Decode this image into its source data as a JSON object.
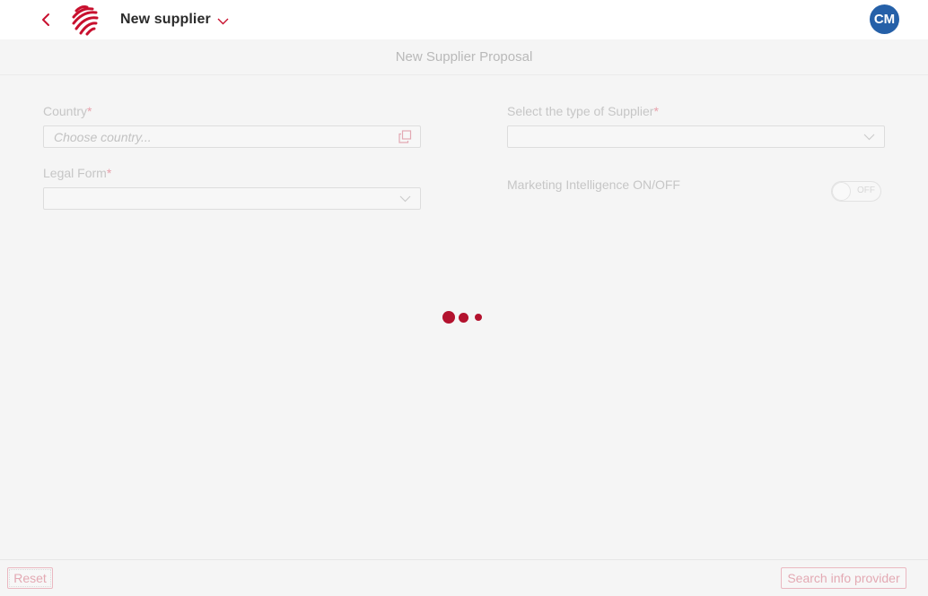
{
  "header": {
    "title": "New supplier",
    "avatar_initials": "CM",
    "avatar_color": "#2560a8",
    "brand_color": "#c8102e"
  },
  "subheader": {
    "title": "New Supplier Proposal"
  },
  "form": {
    "country": {
      "label": "Country",
      "required_mark": "*",
      "placeholder": "Choose country...",
      "value": ""
    },
    "legal_form": {
      "label": "Legal Form",
      "required_mark": "*",
      "value": ""
    },
    "supplier_type": {
      "label": "Select the type of Supplier",
      "required_mark": "*",
      "value": ""
    },
    "marketing_intelligence": {
      "label": "Marketing Intelligence ON/OFF",
      "state_label": "OFF",
      "enabled": false
    }
  },
  "loader": {
    "color": "#b3122e"
  },
  "footer": {
    "reset_label": "Reset",
    "search_label": "Search info provider"
  },
  "icons": {
    "back": "chevron-left-icon",
    "title_dropdown": "chevron-down-icon",
    "country_lookup": "open-lookup-icon",
    "select": "chevron-down-icon"
  }
}
